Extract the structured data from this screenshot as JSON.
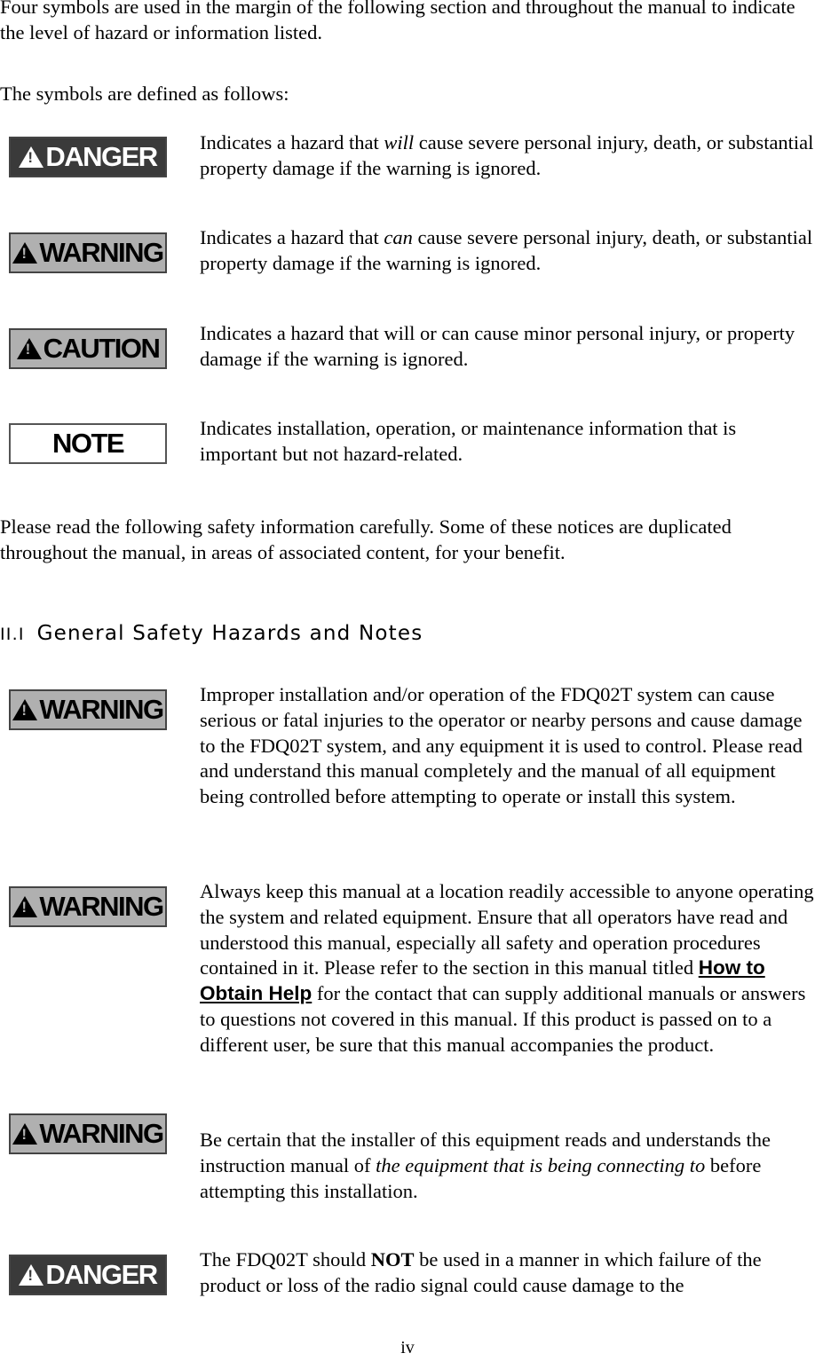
{
  "intro": {
    "p1": "Four symbols are used in the margin of the following section and throughout the manual to indicate the level of hazard or information listed.",
    "p2": "The symbols are defined as follows:"
  },
  "symbols": [
    {
      "badge": "DANGER",
      "pre": "Indicates a hazard that ",
      "em": "will",
      "post": " cause severe personal injury, death, or substantial property damage if the warning is ignored."
    },
    {
      "badge": "WARNING",
      "pre": "Indicates a hazard that ",
      "em": "can",
      "post": " cause severe personal injury, death, or substantial property damage if the warning is ignored."
    },
    {
      "badge": "CAUTION",
      "text": "Indicates a hazard that will or can cause minor personal injury, or property damage if the warning is ignored."
    },
    {
      "badge": "NOTE",
      "text": "Indicates installation, operation, or maintenance information that is important but not hazard-related."
    }
  ],
  "notice": "Please read the following safety information carefully. Some of these notices are duplicated throughout the manual, in areas of associated content, for your benefit.",
  "section": {
    "number": "II.I",
    "title": "General Safety Hazards and Notes"
  },
  "hazards": [
    {
      "badge": "WARNING",
      "text": "Improper installation and/or operation of the FDQ02T system can cause serious or fatal injuries to the operator or nearby persons and cause damage to the FDQ02T system, and any equipment it is used to control. Please read and understand this manual completely and the manual of all equipment being controlled before attempting to operate or install this system."
    },
    {
      "badge": "WARNING",
      "pre": "Always keep this manual at a location readily accessible to anyone operating the system and related equipment. Ensure that all operators have read and understood this manual, especially all safety and operation procedures contained in it. Please refer to the section in this manual titled ",
      "link": "How to Obtain Help",
      "post": " for the contact that can supply additional manuals or answers to questions not covered in this manual. If this product is passed on to a different user, be sure that this manual accompanies the product."
    },
    {
      "badge": "WARNING",
      "pre": "Be certain that the installer of this equipment reads and understands the instruction manual of ",
      "em": "the equipment that is being connecting to",
      "post": " before attempting this installation."
    },
    {
      "badge": "DANGER",
      "pre": "The FDQ02T should ",
      "strong": "NOT",
      "post": " be used in a manner in which failure of the product or loss of the radio signal could cause damage to the"
    }
  ],
  "page_number": "iv"
}
